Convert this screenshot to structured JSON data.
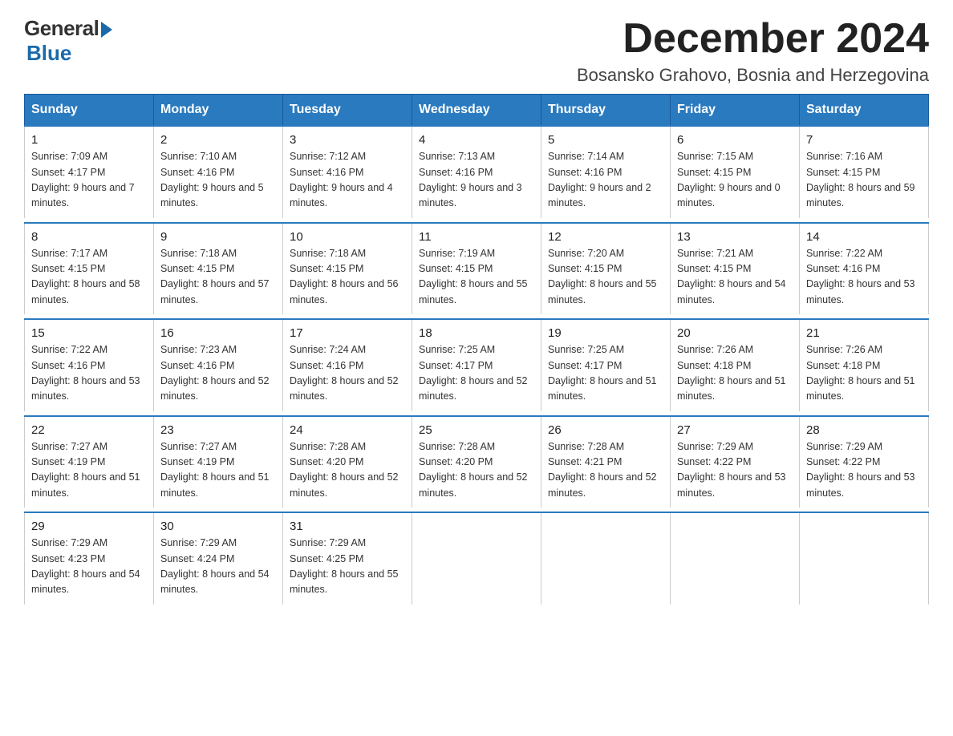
{
  "logo": {
    "general": "General",
    "blue": "Blue"
  },
  "title": "December 2024",
  "subtitle": "Bosansko Grahovo, Bosnia and Herzegovina",
  "days_of_week": [
    "Sunday",
    "Monday",
    "Tuesday",
    "Wednesday",
    "Thursday",
    "Friday",
    "Saturday"
  ],
  "weeks": [
    [
      {
        "day": "1",
        "sunrise": "7:09 AM",
        "sunset": "4:17 PM",
        "daylight": "9 hours and 7 minutes."
      },
      {
        "day": "2",
        "sunrise": "7:10 AM",
        "sunset": "4:16 PM",
        "daylight": "9 hours and 5 minutes."
      },
      {
        "day": "3",
        "sunrise": "7:12 AM",
        "sunset": "4:16 PM",
        "daylight": "9 hours and 4 minutes."
      },
      {
        "day": "4",
        "sunrise": "7:13 AM",
        "sunset": "4:16 PM",
        "daylight": "9 hours and 3 minutes."
      },
      {
        "day": "5",
        "sunrise": "7:14 AM",
        "sunset": "4:16 PM",
        "daylight": "9 hours and 2 minutes."
      },
      {
        "day": "6",
        "sunrise": "7:15 AM",
        "sunset": "4:15 PM",
        "daylight": "9 hours and 0 minutes."
      },
      {
        "day": "7",
        "sunrise": "7:16 AM",
        "sunset": "4:15 PM",
        "daylight": "8 hours and 59 minutes."
      }
    ],
    [
      {
        "day": "8",
        "sunrise": "7:17 AM",
        "sunset": "4:15 PM",
        "daylight": "8 hours and 58 minutes."
      },
      {
        "day": "9",
        "sunrise": "7:18 AM",
        "sunset": "4:15 PM",
        "daylight": "8 hours and 57 minutes."
      },
      {
        "day": "10",
        "sunrise": "7:18 AM",
        "sunset": "4:15 PM",
        "daylight": "8 hours and 56 minutes."
      },
      {
        "day": "11",
        "sunrise": "7:19 AM",
        "sunset": "4:15 PM",
        "daylight": "8 hours and 55 minutes."
      },
      {
        "day": "12",
        "sunrise": "7:20 AM",
        "sunset": "4:15 PM",
        "daylight": "8 hours and 55 minutes."
      },
      {
        "day": "13",
        "sunrise": "7:21 AM",
        "sunset": "4:15 PM",
        "daylight": "8 hours and 54 minutes."
      },
      {
        "day": "14",
        "sunrise": "7:22 AM",
        "sunset": "4:16 PM",
        "daylight": "8 hours and 53 minutes."
      }
    ],
    [
      {
        "day": "15",
        "sunrise": "7:22 AM",
        "sunset": "4:16 PM",
        "daylight": "8 hours and 53 minutes."
      },
      {
        "day": "16",
        "sunrise": "7:23 AM",
        "sunset": "4:16 PM",
        "daylight": "8 hours and 52 minutes."
      },
      {
        "day": "17",
        "sunrise": "7:24 AM",
        "sunset": "4:16 PM",
        "daylight": "8 hours and 52 minutes."
      },
      {
        "day": "18",
        "sunrise": "7:25 AM",
        "sunset": "4:17 PM",
        "daylight": "8 hours and 52 minutes."
      },
      {
        "day": "19",
        "sunrise": "7:25 AM",
        "sunset": "4:17 PM",
        "daylight": "8 hours and 51 minutes."
      },
      {
        "day": "20",
        "sunrise": "7:26 AM",
        "sunset": "4:18 PM",
        "daylight": "8 hours and 51 minutes."
      },
      {
        "day": "21",
        "sunrise": "7:26 AM",
        "sunset": "4:18 PM",
        "daylight": "8 hours and 51 minutes."
      }
    ],
    [
      {
        "day": "22",
        "sunrise": "7:27 AM",
        "sunset": "4:19 PM",
        "daylight": "8 hours and 51 minutes."
      },
      {
        "day": "23",
        "sunrise": "7:27 AM",
        "sunset": "4:19 PM",
        "daylight": "8 hours and 51 minutes."
      },
      {
        "day": "24",
        "sunrise": "7:28 AM",
        "sunset": "4:20 PM",
        "daylight": "8 hours and 52 minutes."
      },
      {
        "day": "25",
        "sunrise": "7:28 AM",
        "sunset": "4:20 PM",
        "daylight": "8 hours and 52 minutes."
      },
      {
        "day": "26",
        "sunrise": "7:28 AM",
        "sunset": "4:21 PM",
        "daylight": "8 hours and 52 minutes."
      },
      {
        "day": "27",
        "sunrise": "7:29 AM",
        "sunset": "4:22 PM",
        "daylight": "8 hours and 53 minutes."
      },
      {
        "day": "28",
        "sunrise": "7:29 AM",
        "sunset": "4:22 PM",
        "daylight": "8 hours and 53 minutes."
      }
    ],
    [
      {
        "day": "29",
        "sunrise": "7:29 AM",
        "sunset": "4:23 PM",
        "daylight": "8 hours and 54 minutes."
      },
      {
        "day": "30",
        "sunrise": "7:29 AM",
        "sunset": "4:24 PM",
        "daylight": "8 hours and 54 minutes."
      },
      {
        "day": "31",
        "sunrise": "7:29 AM",
        "sunset": "4:25 PM",
        "daylight": "8 hours and 55 minutes."
      },
      null,
      null,
      null,
      null
    ]
  ]
}
